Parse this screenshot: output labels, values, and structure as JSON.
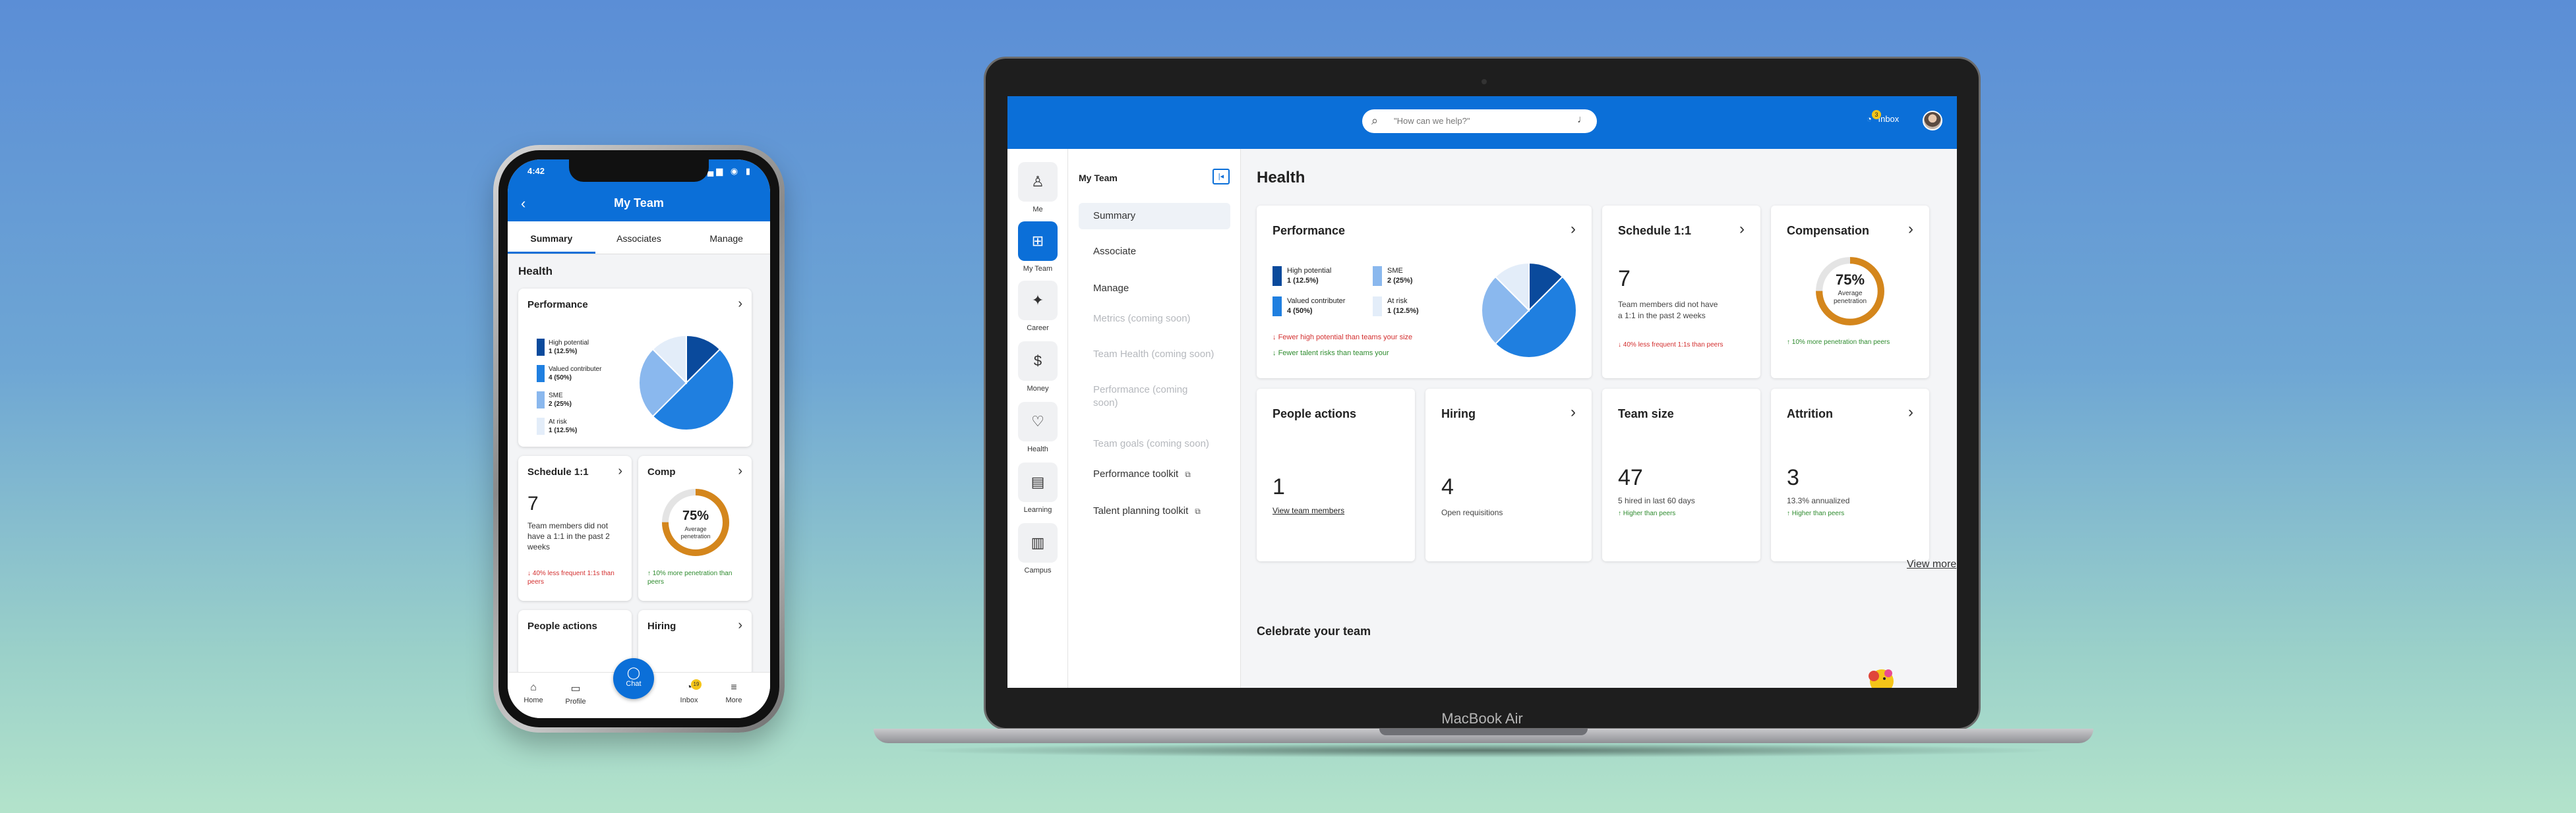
{
  "phone": {
    "time": "4:42",
    "header_title": "My Team",
    "tabs": [
      "Summary",
      "Associates",
      "Manage"
    ],
    "section": "Health",
    "performance": {
      "title": "Performance",
      "legend": [
        {
          "label": "High potential",
          "value": "1 (12.5%)",
          "color": "#0a4a9c"
        },
        {
          "label": "Valued contributer",
          "value": "4 (50%)",
          "color": "#1f7fe0"
        },
        {
          "label": "SME",
          "value": "2 (25%)",
          "color": "#8ab8ee"
        },
        {
          "label": "At risk",
          "value": "1 (12.5%)",
          "color": "#e3edf9"
        }
      ]
    },
    "schedule": {
      "title": "Schedule 1:1",
      "value": "7",
      "desc": "Team members did not have a 1:1 in the past 2 weeks",
      "trend": "40% less frequent 1:1s than peers"
    },
    "comp": {
      "title": "Comp",
      "percent": "75%",
      "label": "Average penetration",
      "trend": "10% more penetration than peers"
    },
    "people_actions": {
      "title": "People actions"
    },
    "hiring": {
      "title": "Hiring"
    },
    "nav": {
      "home": "Home",
      "profile": "Profile",
      "chat": "Chat",
      "inbox": "Inbox",
      "inbox_badge": "19",
      "more": "More"
    }
  },
  "laptop": {
    "label": "MacBook Air",
    "search_placeholder": "\"How can we help?\"",
    "inbox_label": "Inbox",
    "inbox_badge": "3",
    "rail": [
      {
        "label": "Me",
        "icon": "person-icon"
      },
      {
        "label": "My Team",
        "icon": "grid-icon"
      },
      {
        "label": "Career",
        "icon": "sparkle-icon"
      },
      {
        "label": "Money",
        "icon": "dollar-icon"
      },
      {
        "label": "Health",
        "icon": "health-icon"
      },
      {
        "label": "Learning",
        "icon": "book-icon"
      },
      {
        "label": "Campus",
        "icon": "map-icon"
      }
    ],
    "sub": {
      "title": "My Team",
      "items": [
        {
          "label": "Summary"
        },
        {
          "label": "Associate"
        },
        {
          "label": "Manage"
        },
        {
          "label": "Metrics (coming soon)"
        },
        {
          "label": "Team Health (coming soon)"
        },
        {
          "label": "Performance (coming soon)"
        },
        {
          "label": "Team goals (coming soon)"
        },
        {
          "label": "Performance toolkit"
        },
        {
          "label": "Talent planning toolkit"
        }
      ]
    },
    "main": {
      "title": "Health",
      "performance": {
        "title": "Performance",
        "legend": [
          {
            "label": "High potential",
            "value": "1 (12.5%)"
          },
          {
            "label": "Valued contributer",
            "value": "4 (50%)"
          },
          {
            "label": "SME",
            "value": "2 (25%)"
          },
          {
            "label": "At risk",
            "value": "1 (12.5%)"
          }
        ],
        "note_red": "Fewer high potential than teams your size",
        "note_green": "Fewer talent risks than teams your"
      },
      "schedule": {
        "title": "Schedule 1:1",
        "value": "7",
        "desc": "Team members did not have a 1:1 in the past 2 weeks",
        "trend": "40% less frequent 1:1s than peers"
      },
      "compensation": {
        "title": "Compensation",
        "percent": "75%",
        "label": "Average penetration",
        "trend": "10% more penetration than peers"
      },
      "people_actions": {
        "title": "People actions",
        "value": "1",
        "link": "View team members"
      },
      "hiring": {
        "title": "Hiring",
        "value": "4",
        "desc": "Open requisitions"
      },
      "team_size": {
        "title": "Team size",
        "value": "47",
        "desc": "5 hired in last 60 days",
        "trend": "Higher than peers"
      },
      "attrition": {
        "title": "Attrition",
        "value": "3",
        "desc": "13.3% annualized",
        "trend": "Higher than peers"
      },
      "view_more": "View more",
      "celebrate": "Celebrate your team"
    }
  },
  "colors": {
    "brand": "#0b6fd8",
    "high_potential": "#0a4a9c",
    "valued": "#1f7fe0",
    "sme": "#8ab8ee",
    "at_risk": "#e3edf9",
    "ring": "#d4861c"
  },
  "performance_split": [
    1,
    4,
    2,
    1
  ]
}
